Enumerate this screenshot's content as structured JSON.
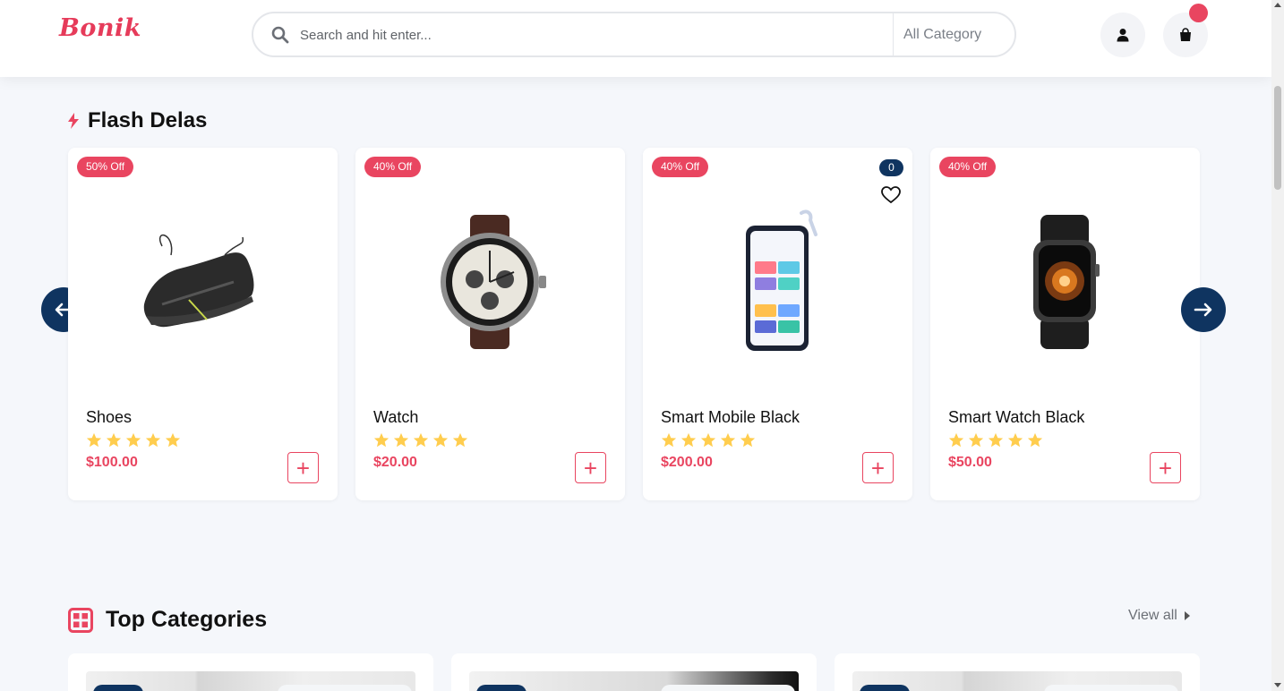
{
  "header": {
    "logo": "Bonik",
    "search_placeholder": "Search and hit enter...",
    "category_select": "All Category",
    "cart_count": ""
  },
  "flash": {
    "title": "Flash Delas",
    "products": [
      {
        "name": "Shoes",
        "discount": "50% Off",
        "price": "$100.00",
        "rating": 5,
        "image": "sneaker"
      },
      {
        "name": "Watch",
        "discount": "40% Off",
        "price": "$20.00",
        "rating": 5,
        "image": "watch"
      },
      {
        "name": "Smart Mobile Black",
        "discount": "40% Off",
        "price": "$200.00",
        "rating": 5,
        "image": "phone",
        "count": "0"
      },
      {
        "name": "Smart Watch Black",
        "discount": "40% Off",
        "price": "$50.00",
        "rating": 5,
        "image": "smartwatch"
      }
    ]
  },
  "categories": {
    "title": "Top Categories",
    "view_all": "View all"
  },
  "colors": {
    "accent": "#e94560",
    "navy": "#0f3460",
    "star": "#ffcd4e",
    "background": "#f5f7fb"
  }
}
